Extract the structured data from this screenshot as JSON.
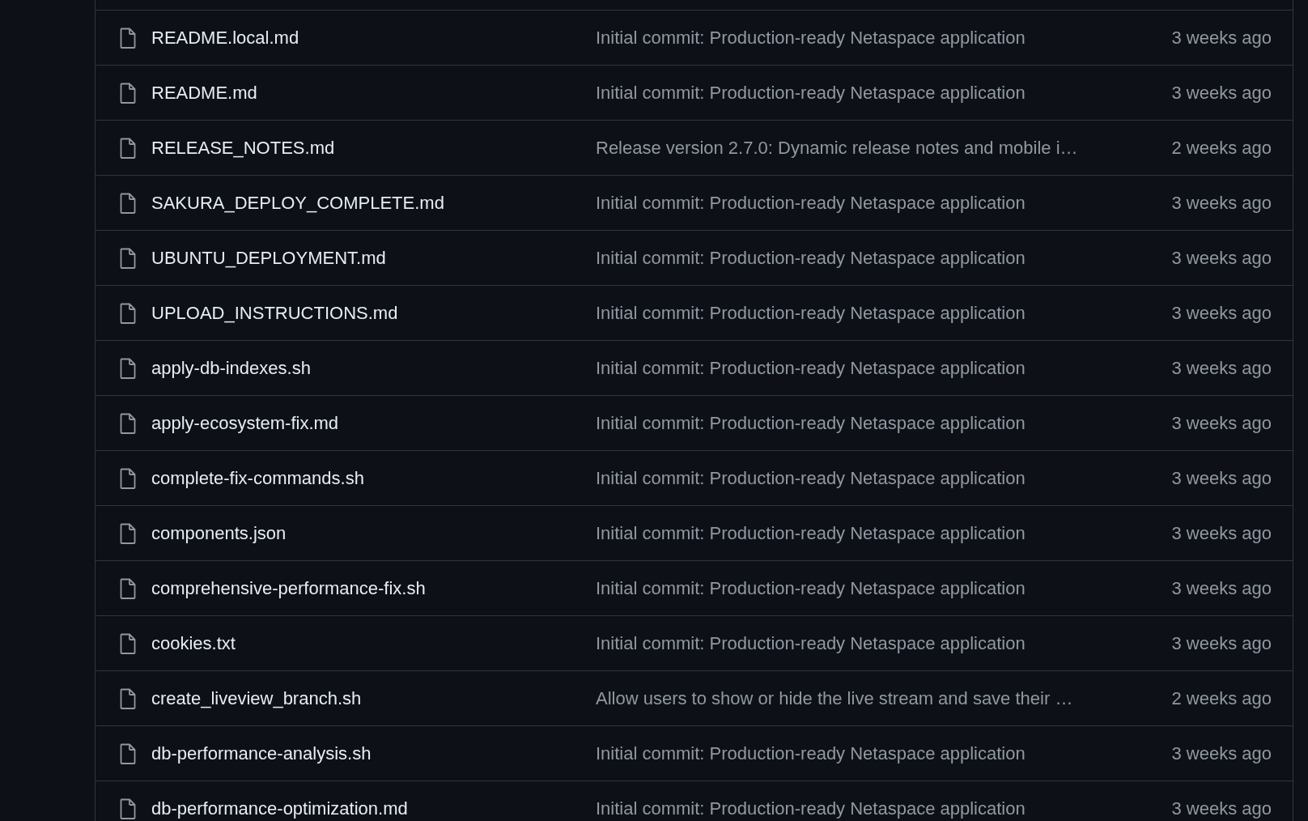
{
  "files": [
    {
      "name": "README.local.md",
      "message": "Initial commit: Production-ready Netaspace application",
      "age": "3 weeks ago"
    },
    {
      "name": "README.md",
      "message": "Initial commit: Production-ready Netaspace application",
      "age": "3 weeks ago"
    },
    {
      "name": "RELEASE_NOTES.md",
      "message": "Release version 2.7.0: Dynamic release notes and mobile i…",
      "age": "2 weeks ago"
    },
    {
      "name": "SAKURA_DEPLOY_COMPLETE.md",
      "message": "Initial commit: Production-ready Netaspace application",
      "age": "3 weeks ago"
    },
    {
      "name": "UBUNTU_DEPLOYMENT.md",
      "message": "Initial commit: Production-ready Netaspace application",
      "age": "3 weeks ago"
    },
    {
      "name": "UPLOAD_INSTRUCTIONS.md",
      "message": "Initial commit: Production-ready Netaspace application",
      "age": "3 weeks ago"
    },
    {
      "name": "apply-db-indexes.sh",
      "message": "Initial commit: Production-ready Netaspace application",
      "age": "3 weeks ago"
    },
    {
      "name": "apply-ecosystem-fix.md",
      "message": "Initial commit: Production-ready Netaspace application",
      "age": "3 weeks ago"
    },
    {
      "name": "complete-fix-commands.sh",
      "message": "Initial commit: Production-ready Netaspace application",
      "age": "3 weeks ago"
    },
    {
      "name": "components.json",
      "message": "Initial commit: Production-ready Netaspace application",
      "age": "3 weeks ago"
    },
    {
      "name": "comprehensive-performance-fix.sh",
      "message": "Initial commit: Production-ready Netaspace application",
      "age": "3 weeks ago"
    },
    {
      "name": "cookies.txt",
      "message": "Initial commit: Production-ready Netaspace application",
      "age": "3 weeks ago"
    },
    {
      "name": "create_liveview_branch.sh",
      "message": "Allow users to show or hide the live stream and save their …",
      "age": "2 weeks ago"
    },
    {
      "name": "db-performance-analysis.sh",
      "message": "Initial commit: Production-ready Netaspace application",
      "age": "3 weeks ago"
    },
    {
      "name": "db-performance-optimization.md",
      "message": "Initial commit: Production-ready Netaspace application",
      "age": "3 weeks ago"
    }
  ]
}
